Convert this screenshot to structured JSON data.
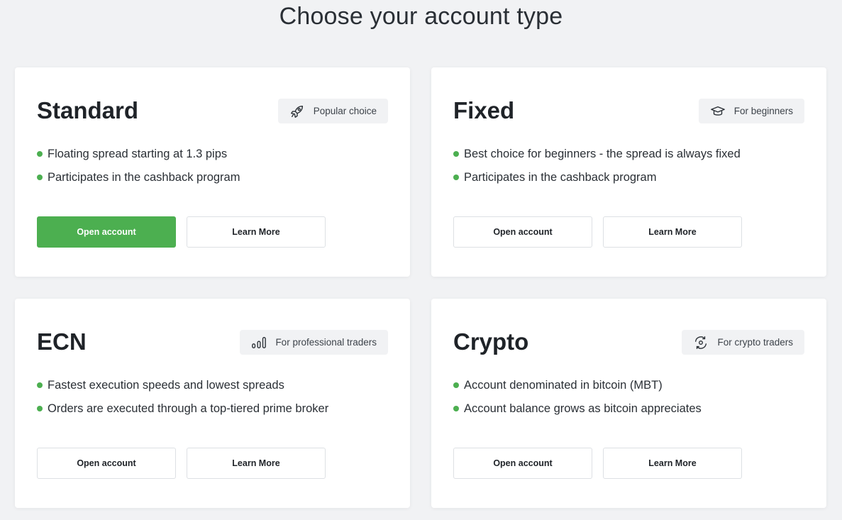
{
  "page": {
    "title": "Choose your account type"
  },
  "colors": {
    "accent": "#4caf50",
    "background": "#f1f2f4",
    "card": "#ffffff"
  },
  "accounts": [
    {
      "name": "Standard",
      "badge": {
        "label": "Popular choice",
        "icon": "rocket-icon"
      },
      "features": [
        "Floating spread starting at 1.3 pips",
        "Participates in the cashback program"
      ],
      "open_label": "Open account",
      "learn_label": "Learn More",
      "primary": true
    },
    {
      "name": "Fixed",
      "badge": {
        "label": "For beginners",
        "icon": "graduation-cap-icon"
      },
      "features": [
        "Best choice for beginners - the spread is always fixed",
        "Participates in the cashback program"
      ],
      "open_label": "Open account",
      "learn_label": "Learn More",
      "primary": false
    },
    {
      "name": "ECN",
      "badge": {
        "label": "For professional traders",
        "icon": "bar-chart-icon"
      },
      "features": [
        "Fastest execution speeds and lowest spreads",
        "Orders are executed through a top-tiered prime broker"
      ],
      "open_label": "Open account",
      "learn_label": "Learn More",
      "primary": false
    },
    {
      "name": "Crypto",
      "badge": {
        "label": "For crypto traders",
        "icon": "crypto-exchange-icon"
      },
      "features": [
        "Account denominated in bitcoin (MBT)",
        "Account balance grows as bitcoin appreciates"
      ],
      "open_label": "Open account",
      "learn_label": "Learn More",
      "primary": false
    }
  ]
}
